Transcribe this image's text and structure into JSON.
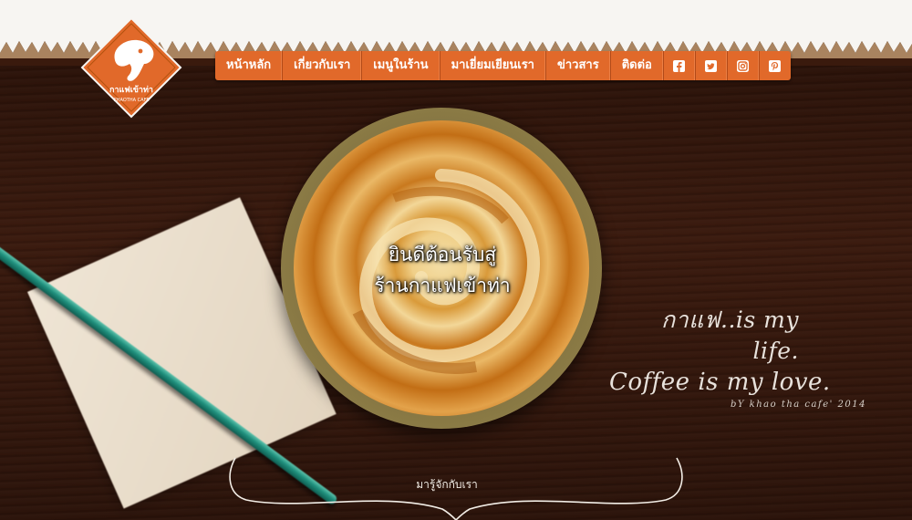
{
  "brand": {
    "logo_thai": "กาแฟเข้าท่า",
    "logo_english": "KHAOTHA CAFE"
  },
  "nav": {
    "items": [
      {
        "label": "หน้าหลัก"
      },
      {
        "label": "เกี่ยวกับเรา"
      },
      {
        "label": "เมนูในร้าน"
      },
      {
        "label": "มาเยี่ยมเยียนเรา"
      },
      {
        "label": "ข่าวสาร"
      },
      {
        "label": "ติดต่อ"
      }
    ],
    "social": [
      "facebook-icon",
      "twitter-icon",
      "instagram-icon",
      "pinterest-icon"
    ],
    "accent": "#e1692a"
  },
  "hero": {
    "welcome_line1": "ยินดีต้อนรับสู่",
    "welcome_line2": "ร้านกาแฟเข้าท่า"
  },
  "slogan": {
    "line1": "กาแฟ..is my life.",
    "line2": "Coffee is my love.",
    "line3": "bY khao tha cafe' 2014"
  },
  "footer": {
    "about_link": "มารู้จักกับเรา"
  }
}
